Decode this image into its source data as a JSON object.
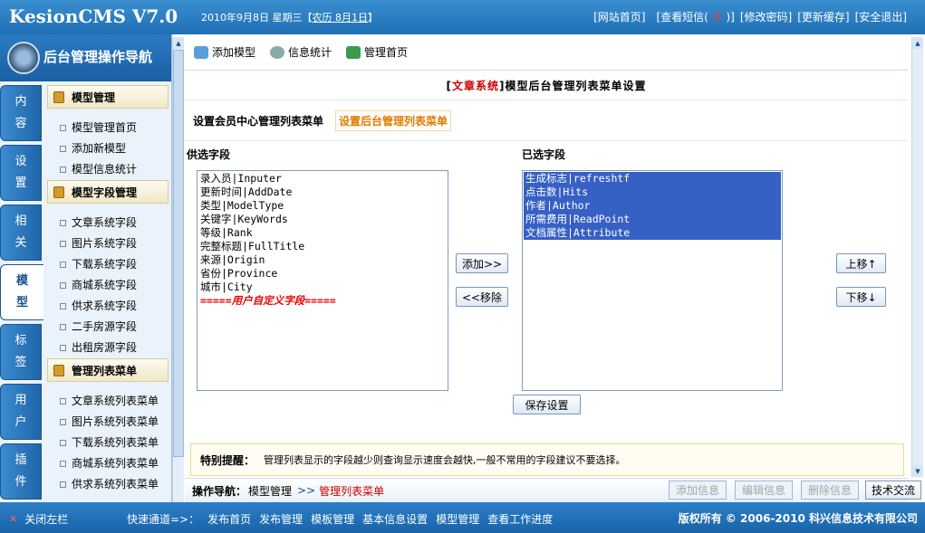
{
  "header": {
    "brand": "KesionCMS V7.0",
    "date": "2010年9月8日 星期三【",
    "lunar": "农历 8月1日",
    "date_end": "】",
    "links": [
      "[网站首页]",
      "[查看短信(",
      "0",
      ")]",
      "[修改密码]",
      "[更新缓存]",
      "[安全退出]"
    ]
  },
  "sidebar": {
    "title": "后台管理操作导航",
    "vtabs": [
      {
        "c1": "内",
        "c2": "容"
      },
      {
        "c1": "设",
        "c2": "置"
      },
      {
        "c1": "相",
        "c2": "关"
      },
      {
        "c1": "模",
        "c2": "型"
      },
      {
        "c1": "标",
        "c2": "签"
      },
      {
        "c1": "用",
        "c2": "户"
      },
      {
        "c1": "插",
        "c2": "件"
      }
    ],
    "groups": [
      {
        "title": "模型管理",
        "items": [
          "模型管理首页",
          "添加新模型",
          "模型信息统计"
        ]
      },
      {
        "title": "模型字段管理",
        "items": [
          "文章系统字段",
          "图片系统字段",
          "下载系统字段",
          "商城系统字段",
          "供求系统字段",
          "二手房源字段",
          "出租房源字段"
        ]
      },
      {
        "title": "管理列表菜单",
        "items": [
          "文章系统列表菜单",
          "图片系统列表菜单",
          "下载系统列表菜单",
          "商城系统列表菜单",
          "供求系统列表菜单"
        ]
      }
    ]
  },
  "toolbar": {
    "add_model": "添加模型",
    "stats": "信息统计",
    "home": "管理首页"
  },
  "page": {
    "title_open": "[",
    "title_system": "文章系统",
    "title_rest": "]模型后台管理列表菜单设置",
    "subtab_member": "设置会员中心管理列表菜单",
    "subtab_admin": "设置后台管理列表菜单",
    "available_label": "供选字段",
    "selected_label": "已选字段",
    "available": [
      "录入员|Inputer",
      "更新时间|AddDate",
      "类型|ModelType",
      "关键字|KeyWords",
      "等级|Rank",
      "完整标题|FullTitle",
      "来源|Origin",
      "省份|Province",
      "城市|City"
    ],
    "custom_divider": "=====用户自定义字段=====",
    "selected": [
      "生成标志|refreshtf",
      "点击数|Hits",
      "作者|Author",
      "所需费用|ReadPoint",
      "文档属性|Attribute"
    ],
    "add_btn": "添加>>",
    "remove_btn": "<<移除",
    "up_btn": "上移↑",
    "down_btn": "下移↓",
    "save_btn": "保存设置",
    "notice_label": "特别提醒：",
    "notice_text": "管理列表显示的字段越少则查询显示速度会越快,一般不常用的字段建议不要选择。"
  },
  "opnav": {
    "label": "操作导航：",
    "path1": "模型管理",
    "sep": ">>",
    "current": "管理列表菜单",
    "buttons": [
      "添加信息",
      "编辑信息",
      "删除信息",
      "技术交流"
    ]
  },
  "footer": {
    "close": "关闭左栏",
    "quick_label": "快速通道=>：",
    "quick": [
      "发布首页",
      "发布管理",
      "模板管理",
      "基本信息设置",
      "模型管理",
      "查看工作进度"
    ],
    "copyright": "版权所有 © 2006-2010 科兴信息技术有限公司"
  }
}
